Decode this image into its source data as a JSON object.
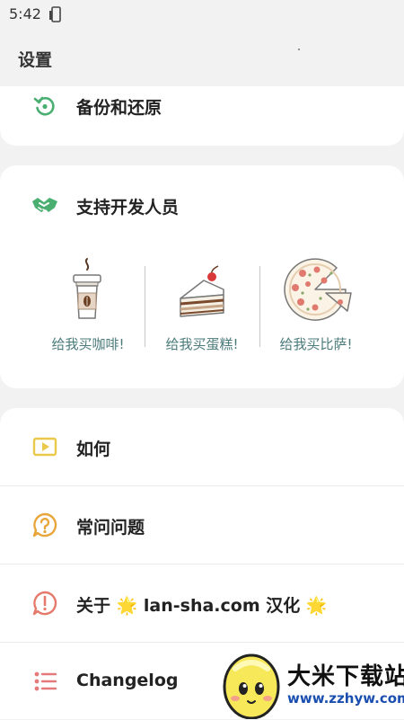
{
  "status_bar": {
    "time": "5:42"
  },
  "header": {
    "title": "设置"
  },
  "backup": {
    "label": "备份和还原"
  },
  "support": {
    "title": "支持开发人员",
    "options": [
      {
        "label": "给我买咖啡!"
      },
      {
        "label": "给我买蛋糕!"
      },
      {
        "label": "给我买比萨!"
      }
    ]
  },
  "menu": {
    "howto": "如何",
    "faq": "常问问题",
    "about": "关于 🌟 lan-sha.com 汉化 🌟",
    "changelog": "Changelog"
  },
  "watermark": {
    "title": "大米下载站",
    "url": "www.zzhyw.com"
  },
  "colors": {
    "backup_icon": "#4caf72",
    "support_icon": "#4caf72",
    "howto_icon": "#e9c84a",
    "faq_icon": "#e8a53a",
    "about_icon": "#e57a6a",
    "changelog_icon": "#e57a7a",
    "donate_text": "#4b7b7b"
  }
}
